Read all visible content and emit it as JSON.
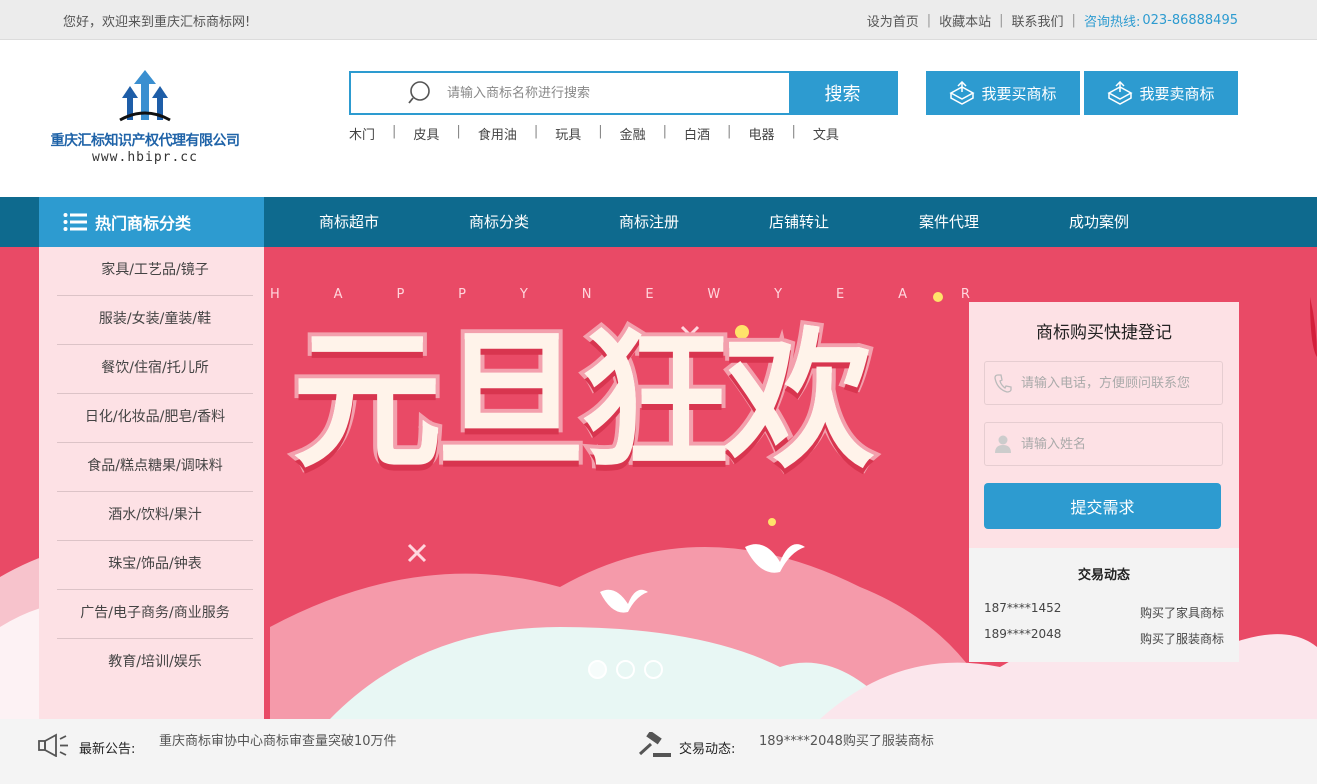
{
  "topbar": {
    "welcome": "您好，欢迎来到重庆汇标商标网!",
    "links": [
      "设为首页",
      "收藏本站",
      "联系我们"
    ],
    "hotline_label": "咨询热线:",
    "hotline_number": "023-86888495"
  },
  "logo": {
    "company": "重庆汇标知识产权代理有限公司",
    "url": "www.hbipr.cc"
  },
  "search": {
    "placeholder": "请输入商标名称进行搜索",
    "button": "搜索"
  },
  "hot_tags": [
    "木门",
    "皮具",
    "食用油",
    "玩具",
    "金融",
    "白酒",
    "电器",
    "文具"
  ],
  "actions": {
    "buy": "我要买商标",
    "sell": "我要卖商标"
  },
  "nav": {
    "category_header": "热门商标分类",
    "items": [
      "商标超市",
      "商标分类",
      "商标注册",
      "店铺转让",
      "案件代理",
      "成功案例"
    ]
  },
  "categories": [
    "家具/工艺品/镜子",
    "服装/女装/童装/鞋",
    "餐饮/住宿/托儿所",
    "日化/化妆品/肥皂/香料",
    "食品/糕点糖果/调味料",
    "酒水/饮料/果汁",
    "珠宝/饰品/钟表",
    "广告/电子商务/商业服务",
    "教育/培训/娱乐"
  ],
  "banner": {
    "tagline_letters": [
      "H",
      "A",
      "P",
      "P",
      "Y",
      "N",
      "E",
      "W",
      "Y",
      "E",
      "A",
      "R"
    ],
    "headline": "元旦狂欢",
    "slides": 3,
    "active_slide": 0
  },
  "register": {
    "title": "商标购买快捷登记",
    "phone_placeholder": "请输入电话，方便顾问联系您",
    "name_placeholder": "请输入姓名",
    "submit": "提交需求"
  },
  "trade_panel": {
    "title": "交易动态",
    "rows": [
      {
        "phone": "187****1452",
        "action": "购买了家具商标"
      },
      {
        "phone": "189****2048",
        "action": "购买了服装商标"
      }
    ]
  },
  "bottom": {
    "notice_label": "最新公告:",
    "notice_text": "重庆商标审协中心商标审查量突破10万件",
    "trade_label": "交易动态:",
    "trade_text": "189****2048购买了服装商标"
  },
  "colors": {
    "accent": "#2d9bd0",
    "nav_bg": "#0e6a8e",
    "banner_bg": "#e94a66",
    "panel_pink": "#fde1e5"
  }
}
